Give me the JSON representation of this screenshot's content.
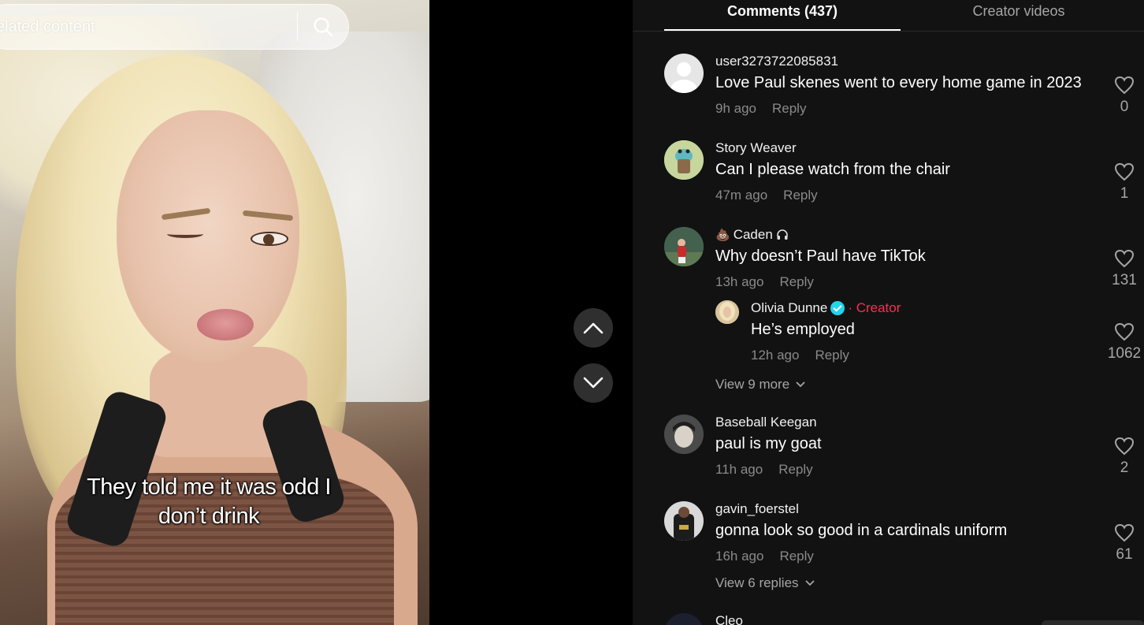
{
  "search": {
    "placeholder_visible": "elated content"
  },
  "video": {
    "caption_line1": "They told me it was odd I",
    "caption_line2": "don’t drink"
  },
  "tabs": {
    "comments": "Comments (437)",
    "creator_videos": "Creator videos"
  },
  "comments": [
    {
      "user": "user3273722085831",
      "text": "Love Paul skenes went to every home game in 2023",
      "time": "9h ago",
      "reply": "Reply",
      "likes": "0"
    },
    {
      "user": "Story Weaver",
      "text": "Can I please watch from the chair",
      "time": "47m ago",
      "reply": "Reply",
      "likes": "1"
    },
    {
      "user": "Caden",
      "text": "Why doesn’t Paul have TikTok",
      "time": "13h ago",
      "reply": "Reply",
      "likes": "131",
      "replies": [
        {
          "user": "Olivia Dunne",
          "tag": "· Creator",
          "text": "He’s employed",
          "time": "12h ago",
          "reply": "Reply",
          "likes": "1062"
        }
      ],
      "view_more": "View 9 more"
    },
    {
      "user": "Baseball Keegan",
      "text": "paul is my goat",
      "time": "11h ago",
      "reply": "Reply",
      "likes": "2"
    },
    {
      "user": "gavin_foerstel",
      "text": "gonna look so good in a cardinals uniform",
      "time": "16h ago",
      "reply": "Reply",
      "likes": "61",
      "view_more": "View 6 replies"
    },
    {
      "user": "Cleo"
    }
  ],
  "colors": {
    "panel_bg": "#121212",
    "creator_tag": "#fe2c55",
    "verified": "#20d5ec",
    "muted_text": "#8a8a8a"
  }
}
